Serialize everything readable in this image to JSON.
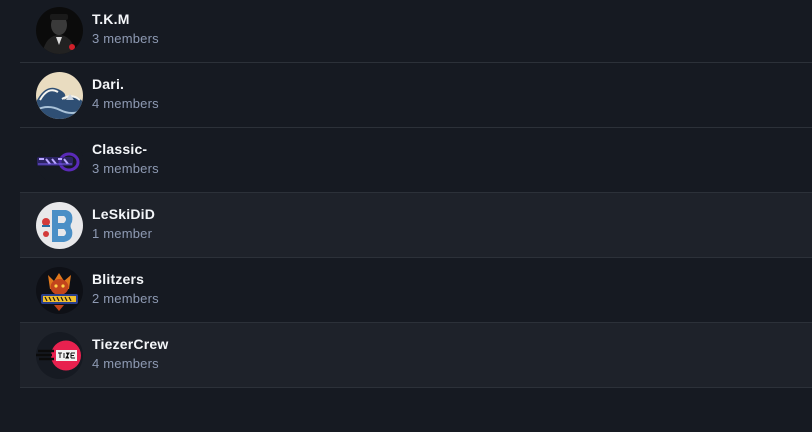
{
  "teams": [
    {
      "name": "T.K.M",
      "members": "3 members",
      "avatar_icon": "godfather-logo-icon"
    },
    {
      "name": "Dari.",
      "members": "4 members",
      "avatar_icon": "great-wave-icon"
    },
    {
      "name": "Classic-",
      "members": "3 members",
      "avatar_icon": "classic-logo-icon"
    },
    {
      "name": "LeSkiDiD",
      "members": "1 member",
      "avatar_icon": "leskidid-logo-icon"
    },
    {
      "name": "Blitzers",
      "members": "2 members",
      "avatar_icon": "blitzers-logo-icon"
    },
    {
      "name": "TiezerCrew",
      "members": "4 members",
      "avatar_icon": "tiezer-crew-logo-icon"
    }
  ],
  "colors": {
    "background": "#161a22",
    "row_highlight": "#1e222a",
    "divider": "#2c3139",
    "name_text": "#f4f6f9",
    "members_text": "#8e9ab3"
  }
}
